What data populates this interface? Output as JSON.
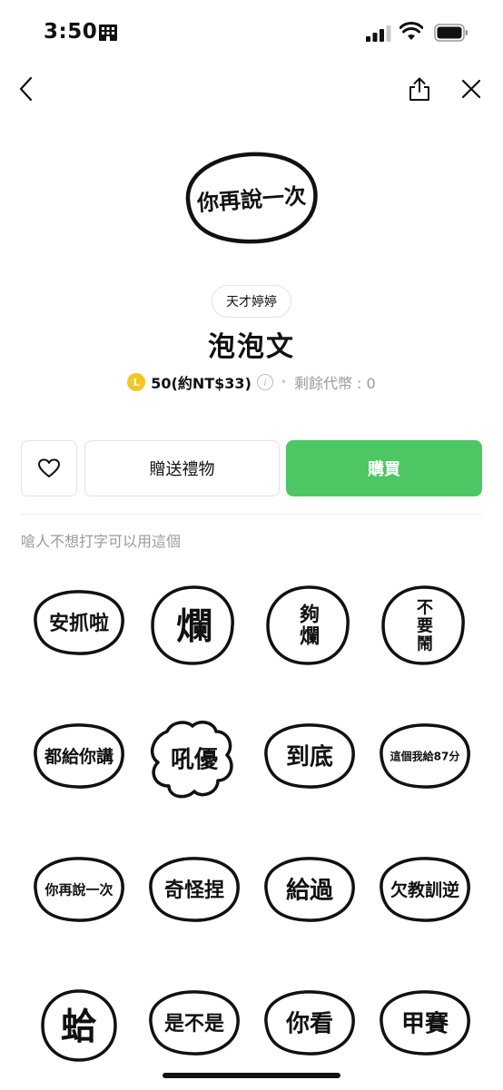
{
  "status": {
    "time": "3:50"
  },
  "header": {
    "sticker_text": "你再說一次"
  },
  "pack": {
    "author": "天才婷婷",
    "title": "泡泡文",
    "coin_symbol": "L",
    "price": "50(約NT$33)",
    "info_symbol": "i",
    "separator": "•",
    "balance": "剩餘代幣 : 0"
  },
  "actions": {
    "gift_label": "贈送禮物",
    "buy_label": "購買"
  },
  "description": "嗆人不想打字可以用這個",
  "colors": {
    "buy_green": "#4cc764",
    "coin_yellow": "#f3c623"
  },
  "stickers": [
    {
      "text": "安抓啦",
      "shape": "oval"
    },
    {
      "text": "爛",
      "shape": "blob"
    },
    {
      "text": "夠爛",
      "shape": "blob",
      "vertical": true
    },
    {
      "text": "不要鬧",
      "shape": "blob",
      "vertical": true
    },
    {
      "text": "都給你講",
      "shape": "oval"
    },
    {
      "text": "吼優",
      "shape": "cloud"
    },
    {
      "text": "到底",
      "shape": "oval"
    },
    {
      "text": "這個我給87分",
      "shape": "oval"
    },
    {
      "text": "你再說一次",
      "shape": "oval"
    },
    {
      "text": "奇怪捏",
      "shape": "oval"
    },
    {
      "text": "給過",
      "shape": "oval"
    },
    {
      "text": "欠教訓逆",
      "shape": "oval"
    },
    {
      "text": "蛤",
      "shape": "circle"
    },
    {
      "text": "是不是",
      "shape": "oval"
    },
    {
      "text": "你看",
      "shape": "oval"
    },
    {
      "text": "甲賽",
      "shape": "oval"
    }
  ]
}
